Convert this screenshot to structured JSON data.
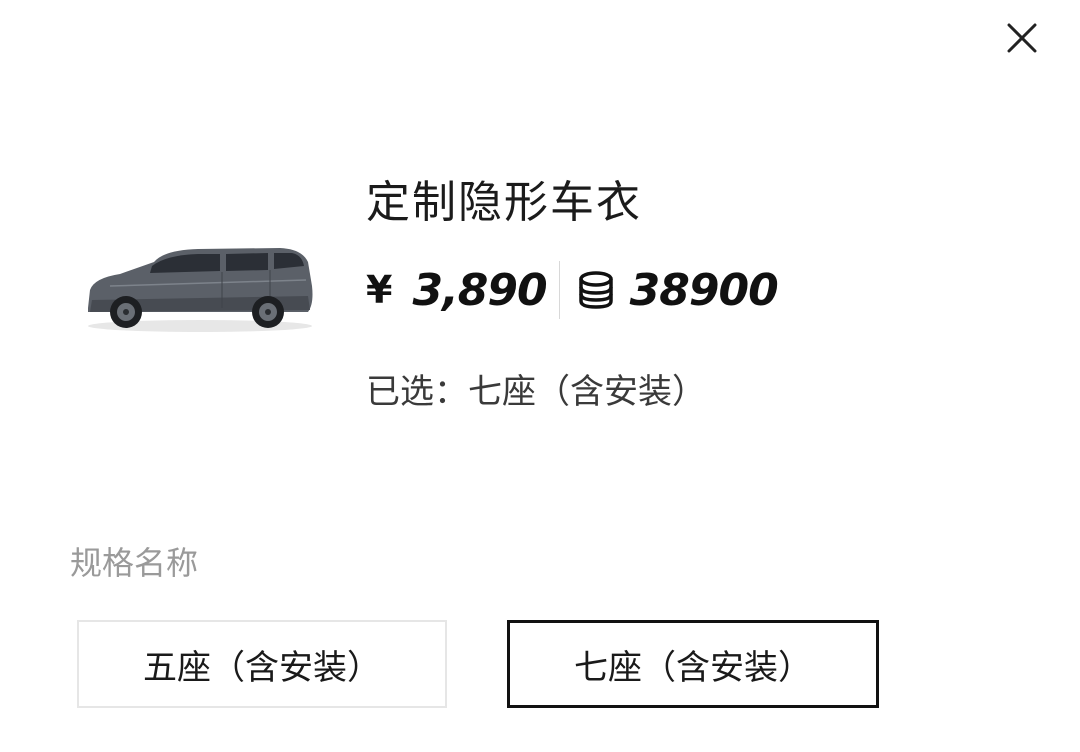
{
  "dialog": {
    "close_icon": "close-icon"
  },
  "product": {
    "image_icon": "car-thumbnail",
    "title": "定制隐形车衣",
    "price_currency_symbol": "¥",
    "price": "3,890",
    "points_icon": "coin-stack-icon",
    "points": "38900",
    "selected_text": "已选：七座（含安装）"
  },
  "spec": {
    "label": "规格名称",
    "options": [
      {
        "label": "五座（含安装）",
        "selected": false
      },
      {
        "label": "七座（含安装）",
        "selected": true
      }
    ]
  },
  "colors": {
    "selected_border": "#111111",
    "unselected_border": "#e6e6e6",
    "muted_text": "#9a9a9a"
  }
}
